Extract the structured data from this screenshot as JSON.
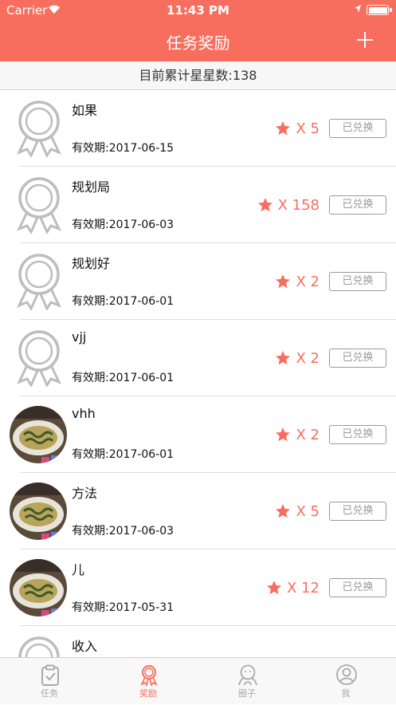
{
  "status_bar": {
    "carrier": "Carrier",
    "time": "11:43 PM"
  },
  "header": {
    "title": "任务奖励"
  },
  "summary": {
    "text": "目前累计星星数:138"
  },
  "rewards": [
    {
      "name": "如果",
      "expiry": "有效期:2017-06-15",
      "stars": "X 5",
      "button": "已兑换",
      "image": "medal"
    },
    {
      "name": "规划局",
      "expiry": "有效期:2017-06-03",
      "stars": "X 158",
      "button": "已兑换",
      "image": "medal"
    },
    {
      "name": "规划好",
      "expiry": "有效期:2017-06-01",
      "stars": "X 2",
      "button": "已兑换",
      "image": "medal"
    },
    {
      "name": "vjj",
      "expiry": "有效期:2017-06-01",
      "stars": "X 2",
      "button": "已兑换",
      "image": "medal"
    },
    {
      "name": "vhh",
      "expiry": "有效期:2017-06-01",
      "stars": "X 2",
      "button": "已兑换",
      "image": "photo"
    },
    {
      "name": "方法",
      "expiry": "有效期:2017-06-03",
      "stars": "X 5",
      "button": "已兑换",
      "image": "photo"
    },
    {
      "name": "儿",
      "expiry": "有效期:2017-05-31",
      "stars": "X 12",
      "button": "已兑换",
      "image": "photo"
    },
    {
      "name": "收入",
      "expiry": "",
      "stars": "",
      "button": "",
      "image": "medal"
    }
  ],
  "tabs": [
    {
      "label": "任务",
      "icon": "clipboard-check-icon",
      "active": false
    },
    {
      "label": "奖励",
      "icon": "medal-icon",
      "active": true
    },
    {
      "label": "圈子",
      "icon": "people-icon",
      "active": false
    },
    {
      "label": "我",
      "icon": "user-icon",
      "active": false
    }
  ],
  "colors": {
    "accent": "#F86E5E",
    "medal_gray": "#BDBDBD",
    "button_gray": "#9A9A9A"
  }
}
